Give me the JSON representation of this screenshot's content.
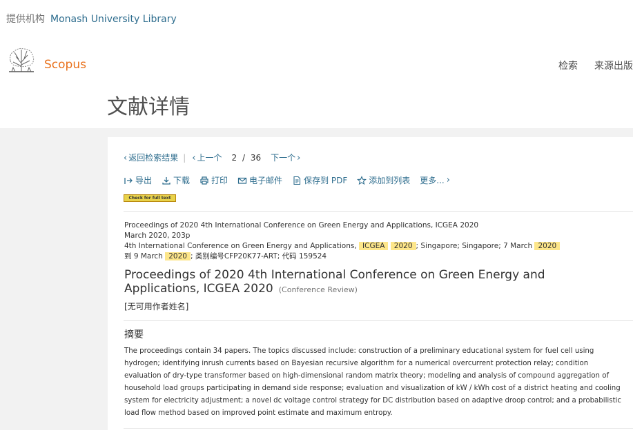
{
  "header": {
    "provided_by_label": "提供机构",
    "institution": "Monash University Library",
    "brand": "Scopus",
    "nav": [
      "检索",
      "来源出版"
    ],
    "page_title": "文献详情"
  },
  "doc_nav": {
    "back": "返回检索结果",
    "prev": "上一个",
    "current": "2",
    "slash": "/",
    "total": "36",
    "next": "下一个"
  },
  "actions": [
    {
      "label": "导出",
      "icon": "export-icon"
    },
    {
      "label": "下载",
      "icon": "download-icon"
    },
    {
      "label": "打印",
      "icon": "print-icon"
    },
    {
      "label": "电子邮件",
      "icon": "email-icon"
    },
    {
      "label": "保存到 PDF",
      "icon": "pdf-icon"
    },
    {
      "label": "添加到列表",
      "icon": "star-icon"
    },
    {
      "label": "更多...",
      "icon": "chevron-right-icon"
    }
  ],
  "check_fulltext": "Check for full text",
  "meta": {
    "line1": "Proceedings of 2020 4th International Conference on Green Energy and Applications, ICGEA 2020",
    "line2": "March 2020, 203p",
    "line3_prefix": "4th International Conference on Green Energy and Applications, ",
    "hl_acronym": "ICGEA",
    "hl_year1": "2020",
    "line3_mid": "; Singapore; Singapore; 7 March ",
    "hl_year2": "2020",
    "line4_prefix": " 到 9 March ",
    "hl_year3": "2020",
    "line4_suffix": "; 类别编号CFP20K77-ART; 代码 159524"
  },
  "doc": {
    "title": "Proceedings of 2020 4th International Conference on Green Energy and Applications, ICGEA 2020",
    "type": "(Conference Review)",
    "authors": "[无可用作者姓名]"
  },
  "abstract": {
    "heading": "摘要",
    "text": "The proceedings contain 34 papers. The topics discussed include: construction of a preliminary educational system for fuel cell using hydrogen; identifying inrush currents based on Bayesian recursive algorithm for a numerical overcurrent protection relay; condition evaluation of dry-type transformer based on high-dimensional random matrix theory; modeling and analysis of compound aggregation of household load groups participating in demand side response; evaluation and visualization of kW / kWh cost of a district heating and cooling system for electricity adjustment; a novel dc voltage control strategy for DC distribution based on adaptive droop control; and a probabilistic load flow method based on improved point estimate and maximum entropy."
  },
  "colors": {
    "link": "#2e6d8e",
    "brand": "#e9711c",
    "highlight": "#fde68a"
  }
}
